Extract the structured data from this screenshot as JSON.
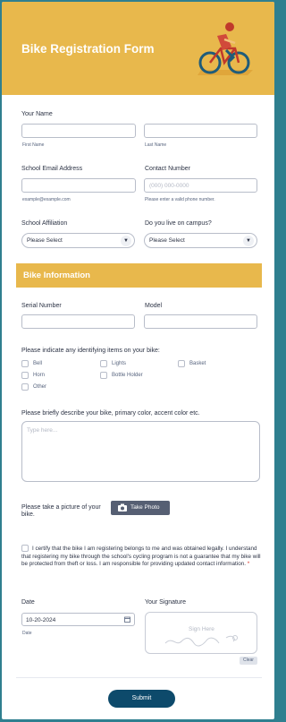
{
  "form": {
    "title": "Bike Registration Form",
    "section_title": "Bike Information"
  },
  "fields": {
    "your_name": {
      "label": "Your Name",
      "first_sub": "First Name",
      "last_sub": "Last Name"
    },
    "email": {
      "label": "School Email Address",
      "sub": "example@example.com"
    },
    "contact": {
      "label": "Contact Number",
      "placeholder": "(000) 000-0000",
      "sub": "Please enter a valid phone number."
    },
    "affiliation": {
      "label": "School Affiliation",
      "value": "Please Select"
    },
    "campus": {
      "label": "Do you live on campus?",
      "value": "Please Select"
    },
    "serial": {
      "label": "Serial Number"
    },
    "model": {
      "label": "Model"
    },
    "items": {
      "label": "Please indicate any identifying items on your bike:",
      "options": [
        "Bell",
        "Lights",
        "Basket",
        "Horn",
        "Bottle Holder",
        "Other"
      ]
    },
    "describe": {
      "label": "Please briefly describe your bike, primary color, accent color etc.",
      "placeholder": "Type here..."
    },
    "photo": {
      "label_line1": "Please take a picture of your",
      "label_line2": "bike.",
      "button": "Take Photo"
    },
    "certify": {
      "text": "I certify that the bike I am registering belongs to me and was obtained legally. I understand that registering my bike through the school's cycling program is not a guarantee that my bike will be protected from theft or loss. I am responsible for providing updated contact information.",
      "required_mark": "*"
    },
    "date": {
      "label": "Date",
      "value": "10-20-2024",
      "sub": "Date"
    },
    "signature": {
      "label": "Your Signature",
      "placeholder": "Sign Here",
      "clear": "Clear"
    }
  },
  "submit": "Submit",
  "colors": {
    "accent": "#e8b84c",
    "submit": "#0d4a6b",
    "border": "#2f7f8f"
  }
}
